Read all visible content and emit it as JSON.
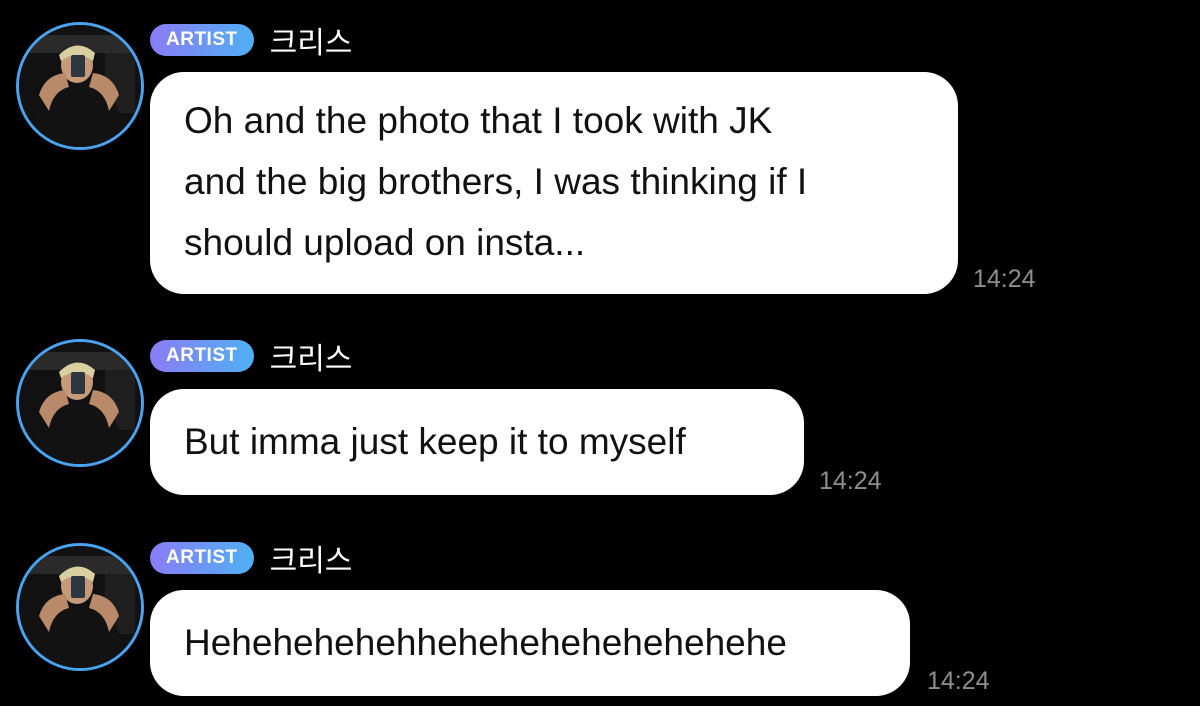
{
  "messages": [
    {
      "badge": "ARTIST",
      "name": "크리스",
      "lines": [
        "Oh and the photo that I took with JK",
        "and the big brothers, I was thinking if I",
        "should upload on insta..."
      ],
      "time": "14:24"
    },
    {
      "badge": "ARTIST",
      "name": "크리스",
      "lines": [
        "But imma just keep it to myself"
      ],
      "time": "14:24"
    },
    {
      "badge": "ARTIST",
      "name": "크리스",
      "lines": [
        "Hehehehehehhehehehehehehehehe"
      ],
      "time": "14:24"
    }
  ],
  "colors": {
    "background": "#000000",
    "bubble": "#ffffff",
    "badge_start": "#8a7cf5",
    "badge_end": "#4fb0f3",
    "avatar_ring": "#4aa3f0",
    "timestamp": "#8e8e8e"
  },
  "icons": {
    "avatar": "profile-photo-mirror-selfie"
  }
}
